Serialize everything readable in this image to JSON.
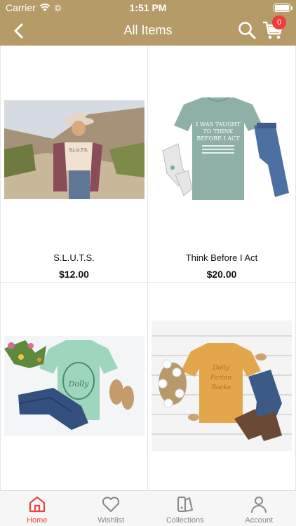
{
  "status_bar": {
    "carrier": "Carrier",
    "time": "1:51 PM"
  },
  "nav": {
    "title": "All Items",
    "cart_count": "0",
    "icons": [
      "back-chevron-icon",
      "search-icon",
      "cart-icon"
    ]
  },
  "products": [
    {
      "name": "S.L.U.T.S.",
      "price": "$12.00"
    },
    {
      "name": "Think Before I Act",
      "price": "$20.00"
    },
    {
      "name": "",
      "price": ""
    },
    {
      "name": "",
      "price": ""
    }
  ],
  "tabs": [
    {
      "label": "Home",
      "icon": "home-icon",
      "active": true
    },
    {
      "label": "Wishlist",
      "icon": "heart-icon",
      "active": false
    },
    {
      "label": "Collections",
      "icon": "collections-icon",
      "active": false
    },
    {
      "label": "Account",
      "icon": "account-icon",
      "active": false
    }
  ],
  "colors": {
    "brand": "#b59b67",
    "active_tab": "#e8473f",
    "badge": "#ef3b3b"
  }
}
